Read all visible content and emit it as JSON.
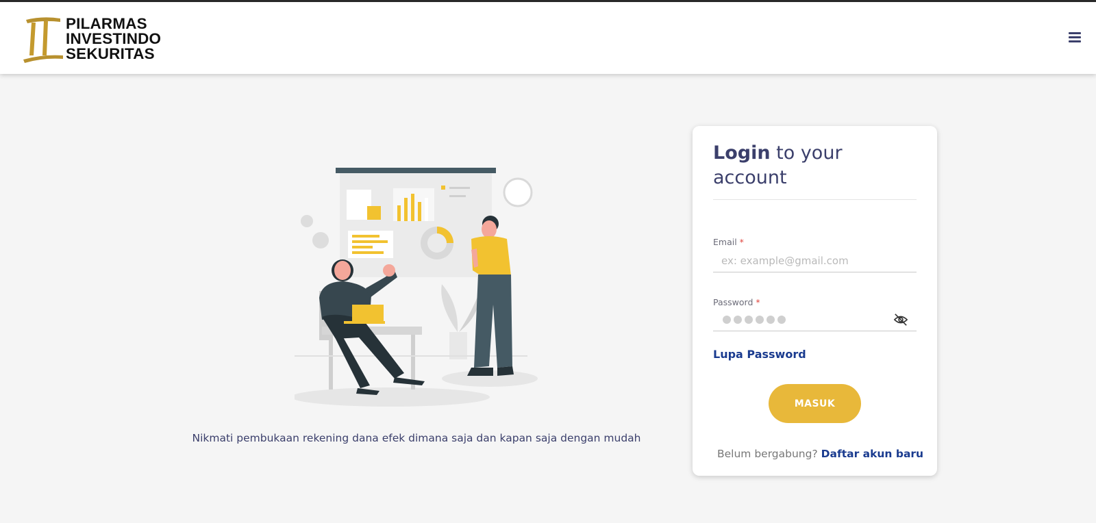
{
  "header": {
    "brand_lines": [
      "PILARMAS",
      "INVESTINDO",
      "SEKURITAS"
    ],
    "menu_icon": "hamburger-menu-icon"
  },
  "hero": {
    "tagline": "Nikmati pembukaan rekening dana efek dimana saja dan kapan saja dengan mudah"
  },
  "login": {
    "title_bold": "Login",
    "title_rest": " to your account",
    "email": {
      "label": "Email",
      "required_mark": "*",
      "placeholder": "ex: example@gmail.com",
      "value": ""
    },
    "password": {
      "label": "Password",
      "required_mark": "*",
      "visibility_icon": "eye-off-icon"
    },
    "forgot_label": "Lupa Password",
    "submit_label": "MASUK",
    "signup_prompt": "Belum bergabung?",
    "signup_link": "Daftar akun baru"
  },
  "colors": {
    "accent": "#e8b83a",
    "primary_text": "#3b3f6b",
    "link": "#1a3b8f",
    "required": "#e0443d"
  }
}
